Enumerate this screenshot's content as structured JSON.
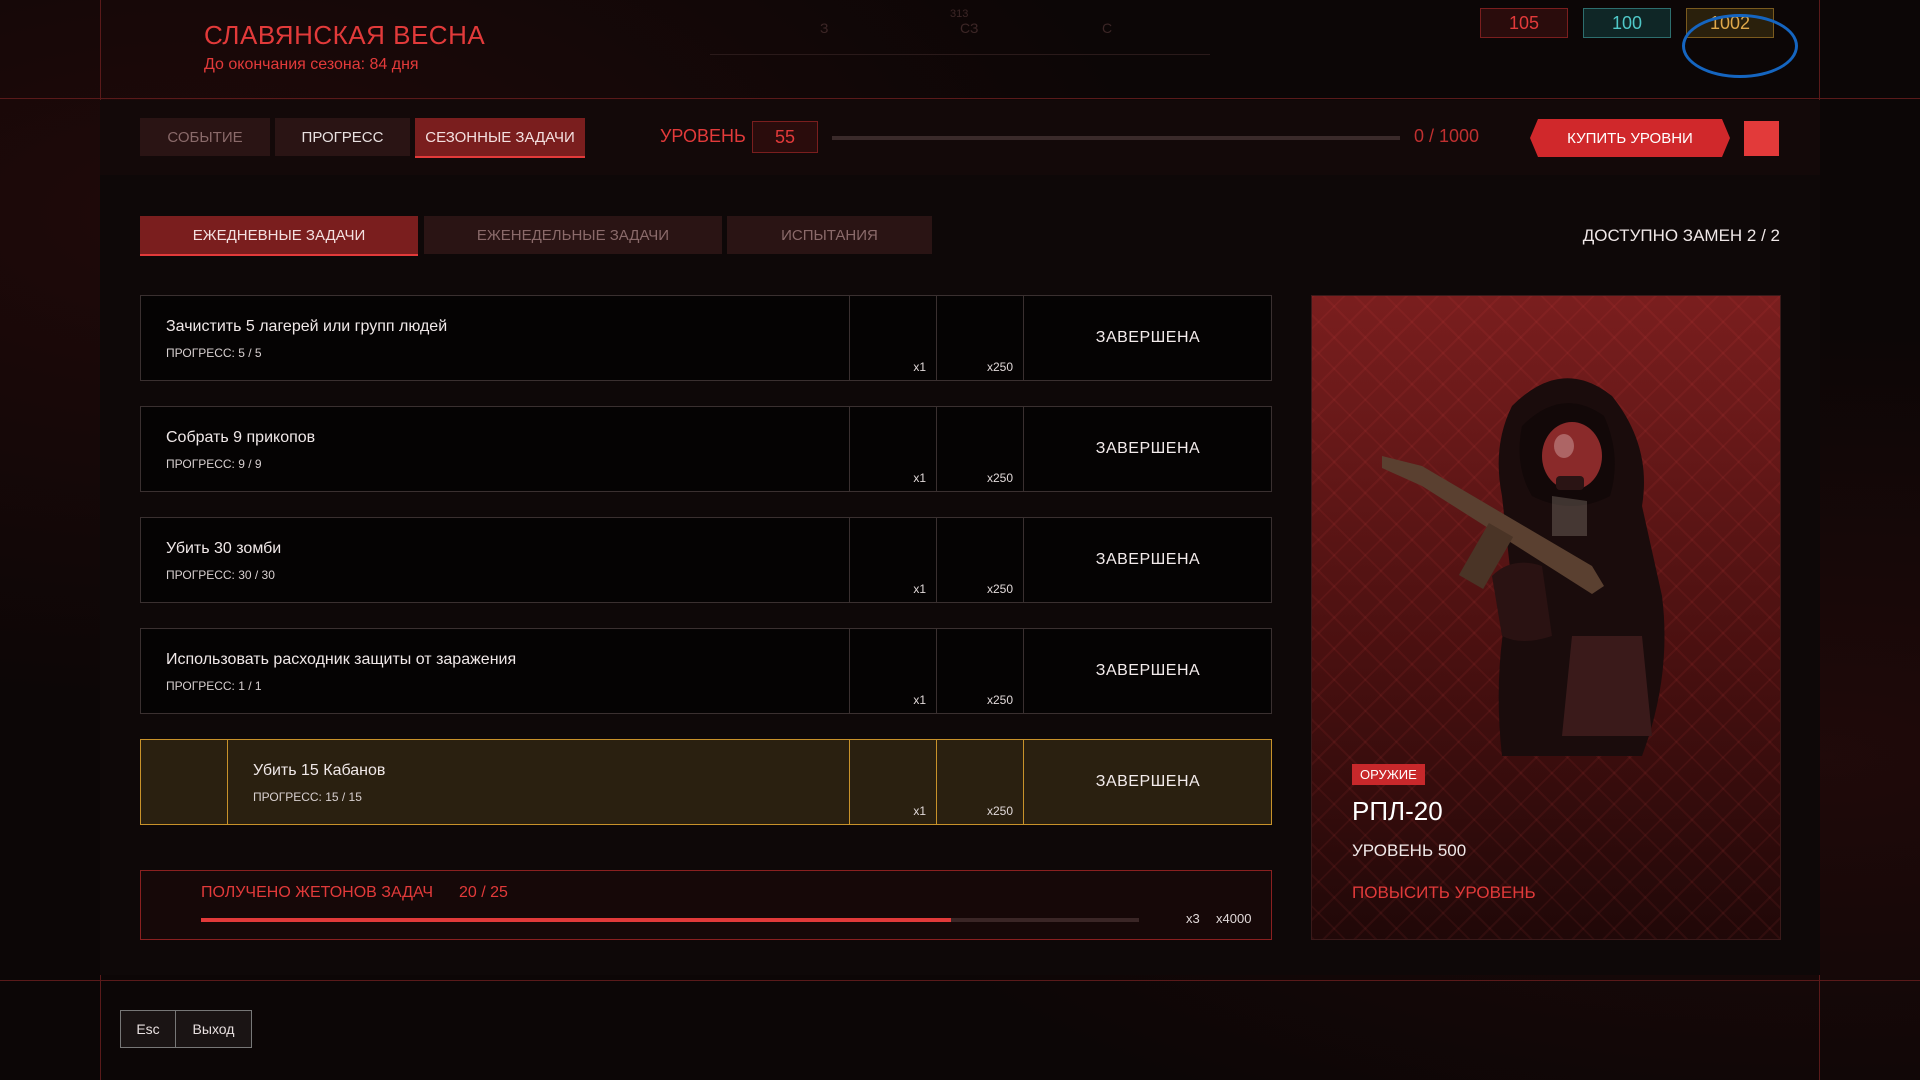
{
  "header": {
    "title": "СЛАВЯНСКАЯ ВЕСНА",
    "subtitle": "До окончания сезона: 84 дня",
    "compass": {
      "left": "З",
      "heading": "313",
      "center": "СЗ",
      "right": "С"
    },
    "currency": [
      {
        "value": "105",
        "color": "#e23a3a"
      },
      {
        "value": "100",
        "color": "#4fc7c7"
      },
      {
        "value": "1002",
        "color": "#e0a84a"
      }
    ]
  },
  "nav": {
    "tabs": [
      "СОБЫТИЕ",
      "ПРОГРЕСС",
      "СЕЗОННЫЕ ЗАДАЧИ"
    ],
    "active_tab": "СЕЗОННЫЕ ЗАДАЧИ",
    "level_label": "УРОВЕНЬ",
    "level_value": "55",
    "level_progress_text": "0 / 1000",
    "level_progress_fraction": 0,
    "buy_label": "КУПИТЬ УРОВНИ"
  },
  "subtabs": {
    "items": [
      "ЕЖЕДНЕВНЫЕ ЗАДАЧИ",
      "ЕЖЕНЕДЕЛЬНЫЕ ЗАДАЧИ",
      "ИСПЫТАНИЯ"
    ],
    "active": "ЕЖЕДНЕВНЫЕ ЗАДАЧИ",
    "swaps": "ДОСТУПНО ЗАМЕН 2 / 2"
  },
  "tasks": [
    {
      "name": "Зачистить 5 лагерей или групп людей",
      "progress": "ПРОГРЕСС: 5 / 5",
      "reward1": "x1",
      "reward2": "x250",
      "status": "ЗАВЕРШЕНА"
    },
    {
      "name": "Собрать 9 прикопов",
      "progress": "ПРОГРЕСС: 9 / 9",
      "reward1": "x1",
      "reward2": "x250",
      "status": "ЗАВЕРШЕНА"
    },
    {
      "name": "Убить 30 зомби",
      "progress": "ПРОГРЕСС: 30 / 30",
      "reward1": "x1",
      "reward2": "x250",
      "status": "ЗАВЕРШЕНА"
    },
    {
      "name": "Использовать расходник защиты от заражения",
      "progress": "ПРОГРЕСС: 1 / 1",
      "reward1": "x1",
      "reward2": "x250",
      "status": "ЗАВЕРШЕНА"
    },
    {
      "name": "Убить 15 Кабанов",
      "progress": "ПРОГРЕСС: 15 / 15",
      "reward1": "x1",
      "reward2": "x250",
      "status": "ЗАВЕРШЕНА"
    }
  ],
  "tokens": {
    "label": "ПОЛУЧЕНО ЖЕТОНОВ ЗАДАЧ",
    "value": "20 / 25",
    "fraction": 0.8,
    "reward1": "x3",
    "reward2": "x4000"
  },
  "reward_card": {
    "badge": "ОРУЖИЕ",
    "name": "РПЛ-20",
    "level": "УРОВЕНЬ 500",
    "upgrade": "ПОВЫСИТЬ УРОВЕНЬ"
  },
  "footer": {
    "key": "Esc",
    "label": "Выход"
  }
}
